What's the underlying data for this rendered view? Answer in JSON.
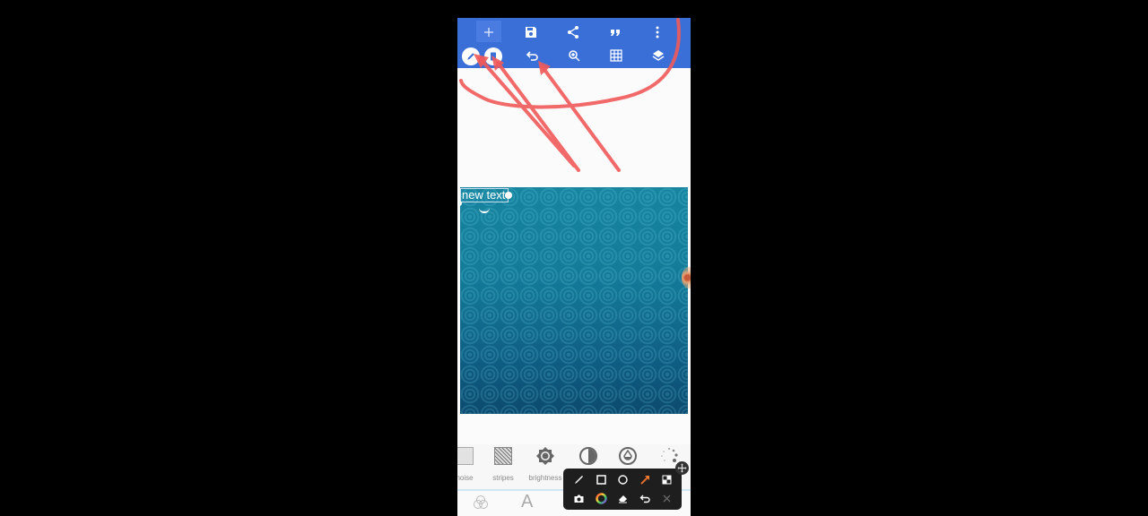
{
  "app": {
    "toolbar_top": [
      {
        "name": "add-button",
        "icon": "plus-icon",
        "glyph": "+"
      },
      {
        "name": "save-button",
        "icon": "save-icon"
      },
      {
        "name": "share-button",
        "icon": "share-icon"
      },
      {
        "name": "quote-button",
        "icon": "quote-icon",
        "glyph": "”"
      },
      {
        "name": "more-button",
        "icon": "more-vert-icon"
      }
    ],
    "toolbar_bottom": [
      {
        "name": "draw-button",
        "icon": "pencil-icon"
      },
      {
        "name": "copy-button",
        "icon": "phone-icon"
      },
      {
        "name": "undo-button",
        "icon": "undo-icon"
      },
      {
        "name": "zoom-button",
        "icon": "zoom-in-icon"
      },
      {
        "name": "grid-button",
        "icon": "grid-icon"
      },
      {
        "name": "layers-button",
        "icon": "layers-icon"
      }
    ],
    "accent_color": "#3b6fd8",
    "annotation_color": "#f05a5a"
  },
  "canvas": {
    "text_layer": "new text"
  },
  "tools": [
    {
      "label": "noise",
      "icon": "noise-icon"
    },
    {
      "label": "stripes",
      "icon": "stripes-icon"
    },
    {
      "label": "brightness",
      "icon": "brightness-icon"
    },
    {
      "label": "contrast",
      "icon": "contrast-icon"
    },
    {
      "label": "saturation",
      "icon": "saturation-icon"
    },
    {
      "label": "blur",
      "icon": "blur-icon"
    }
  ],
  "bottom_nav": [
    {
      "name": "filters-tab",
      "icon": "color-circles-icon"
    },
    {
      "name": "text-tab",
      "icon": "text-icon",
      "glyph": "A"
    }
  ],
  "floating_panel": {
    "row1": [
      "brush-icon",
      "rectangle-icon",
      "circle-icon",
      "arrow-icon",
      "highlight-icon"
    ],
    "row2": [
      "camera-icon",
      "color-wheel-icon",
      "eraser-icon",
      "undo-icon",
      "close-icon"
    ]
  }
}
